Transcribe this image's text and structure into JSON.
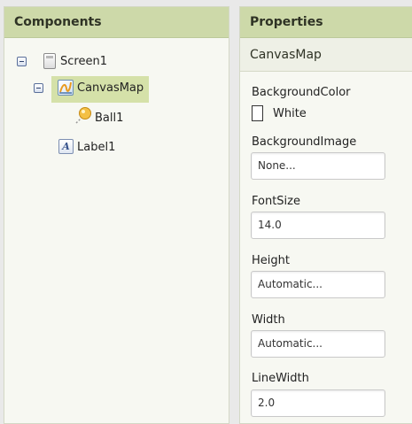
{
  "components": {
    "title": "Components",
    "tree": {
      "screen": "Screen1",
      "canvas": "CanvasMap",
      "ball": "Ball1",
      "label": "Label1"
    }
  },
  "properties": {
    "title": "Properties",
    "component": "CanvasMap",
    "background_color": {
      "label": "BackgroundColor",
      "value": "White",
      "color": "#ffffff"
    },
    "background_image": {
      "label": "BackgroundImage",
      "value": "None..."
    },
    "font_size": {
      "label": "FontSize",
      "value": "14.0"
    },
    "height": {
      "label": "Height",
      "value": "Automatic..."
    },
    "width": {
      "label": "Width",
      "value": "Automatic..."
    },
    "line_width": {
      "label": "LineWidth",
      "value": "2.0"
    }
  },
  "icons": {
    "collapse": "minus-box-icon",
    "screen": "screen-icon",
    "canvas": "canvas-icon",
    "ball": "ball-icon",
    "label": "label-icon"
  },
  "colors": {
    "header_bg": "#cdd9a9",
    "selected_bg": "#d5e1a9",
    "panel_bg": "#f7f8f2"
  }
}
